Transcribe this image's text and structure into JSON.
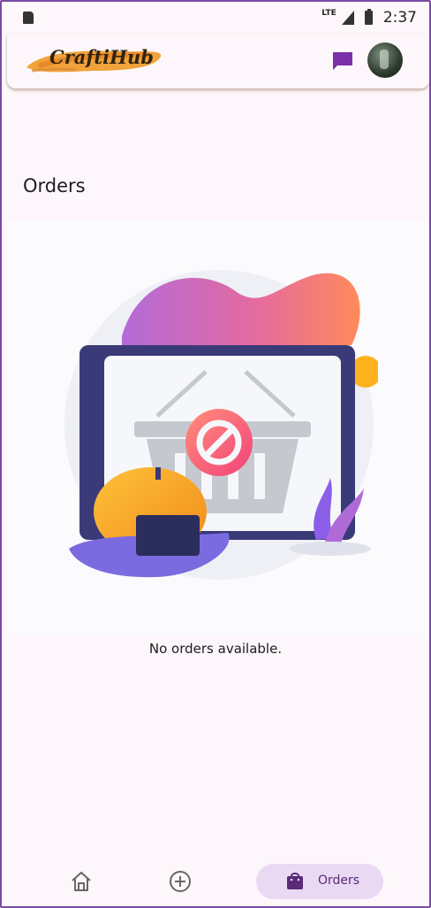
{
  "status_bar": {
    "network": "LTE",
    "time": "2:37"
  },
  "app_bar": {
    "logo_text": "CraftiHub"
  },
  "page": {
    "title": "Orders",
    "empty_message": "No orders available."
  },
  "bottom_nav": {
    "orders_label": "Orders"
  },
  "colors": {
    "accent": "#7b2fa8",
    "nav_active_bg": "#ead9f2",
    "background": "#fdf7fb"
  }
}
